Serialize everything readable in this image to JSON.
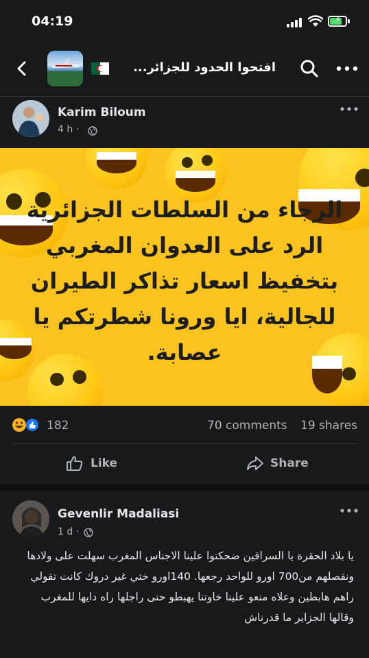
{
  "status_bar": {
    "time": "04:19"
  },
  "nav": {
    "group_title": "افتحوا الحدود للجزائر..."
  },
  "post": {
    "author": "Karim Biloum",
    "age": "4 h",
    "poster_text": "الرجاء من السلطات الجزائرية الرد على العدوان المغربي بتخفيظ اسعار تذاكر الطيران للجالية، ايا ورونا شطرتكم يا عصابة.",
    "reaction_count": "182",
    "comments": "70 comments",
    "shares": "19 shares",
    "like_label": "Like",
    "share_label": "Share"
  },
  "comment": {
    "author": "Gevenlir Madaliasi",
    "age": "1 d",
    "text": "يا بلاد الحقرة يا السراقين ضحكتوا علينا الاجناس المغرب سهلت على ولادها ونقصلهم من700 اورو للواحد رجعها. 140اورو ختي غير دروك كانت تقولي راهم هابطين وعلاه منعو علينا خاوتنا يهبطو حتى راجلها راه دايها للمغرب وقالها الجزاير ما قدرناش"
  },
  "colors": {
    "background": "#18191a",
    "poster": "#fac31f",
    "like_reaction": "#1877f2",
    "haha_reaction": "#f7b125"
  }
}
